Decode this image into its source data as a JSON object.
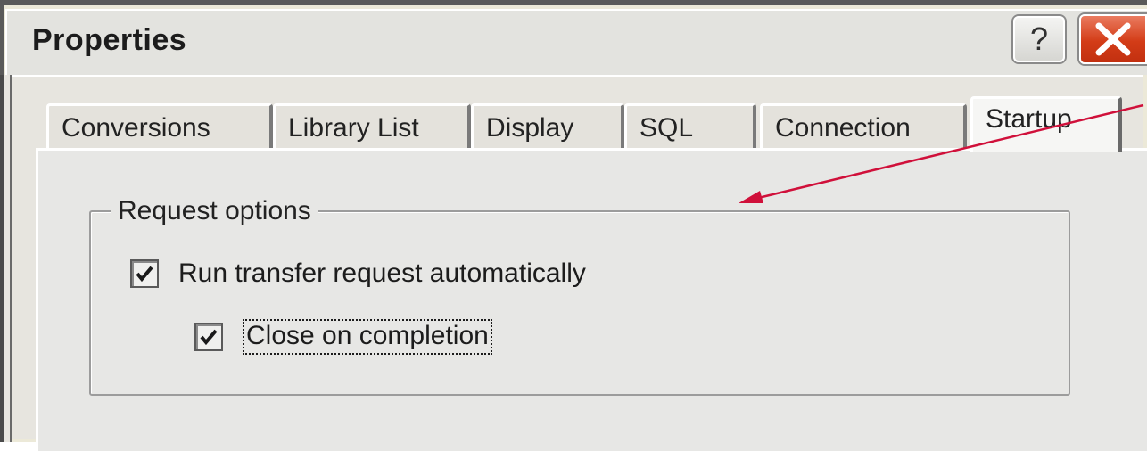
{
  "window": {
    "title": "Properties",
    "help_label": "?",
    "close_icon": "close-x-icon"
  },
  "tabs": [
    {
      "label": "Conversions",
      "active": false
    },
    {
      "label": "Library List",
      "active": false
    },
    {
      "label": "Display",
      "active": false
    },
    {
      "label": "SQL",
      "active": false
    },
    {
      "label": "Connection",
      "active": false
    },
    {
      "label": "Startup",
      "active": true
    }
  ],
  "request_options": {
    "legend": "Request options",
    "run_automatically": {
      "label": "Run transfer request automatically",
      "checked": true
    },
    "close_on_completion": {
      "label": "Close on completion",
      "checked": true,
      "focused": true
    }
  },
  "colors": {
    "annotation_arrow": "#d0103a",
    "close_button": "#d33c17"
  }
}
